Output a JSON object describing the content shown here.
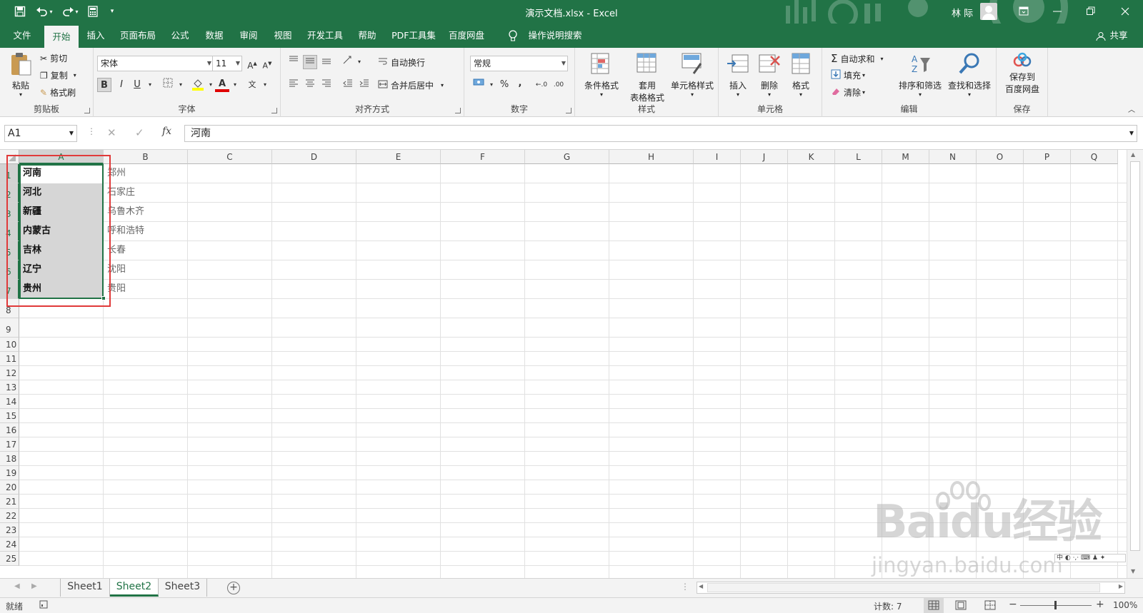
{
  "window": {
    "title": "演示文档.xlsx  -  Excel",
    "user": "林 际"
  },
  "quick_access": {
    "save": "save-icon",
    "undo": "undo-icon",
    "redo": "redo-icon"
  },
  "tabs": [
    "文件",
    "开始",
    "插入",
    "页面布局",
    "公式",
    "数据",
    "审阅",
    "视图",
    "开发工具",
    "帮助",
    "PDF工具集",
    "百度网盘",
    "操作说明搜索"
  ],
  "active_tab": "开始",
  "share": "共享",
  "ribbon": {
    "clipboard": {
      "paste": "粘贴",
      "cut": "剪切",
      "copy": "复制",
      "format_painter": "格式刷",
      "label": "剪贴板"
    },
    "font": {
      "name": "宋体",
      "size": "11",
      "bold": "B",
      "italic": "I",
      "underline": "U",
      "phonetic": "文",
      "label": "字体"
    },
    "alignment": {
      "wrap": "自动换行",
      "merge": "合并后居中",
      "label": "对齐方式"
    },
    "number": {
      "format": "常规",
      "percent": "%",
      "comma": ",",
      "label": "数字"
    },
    "styles": {
      "conditional": "条件格式",
      "table_line1": "套用",
      "table_line2": "表格格式",
      "cell_styles": "单元格样式",
      "label": "样式"
    },
    "cells": {
      "insert": "插入",
      "delete": "删除",
      "format": "格式",
      "label": "单元格"
    },
    "editing": {
      "autosum": "自动求和",
      "fill": "填充",
      "clear": "清除",
      "sort": "排序和筛选",
      "find": "查找和选择",
      "label": "编辑"
    },
    "save": {
      "line1": "保存到",
      "line2": "百度网盘",
      "label": "保存"
    }
  },
  "formula_bar": {
    "name_box": "A1",
    "fx": "fx",
    "value": "河南"
  },
  "columns": [
    "A",
    "B",
    "C",
    "D",
    "E",
    "F",
    "G",
    "H",
    "I",
    "J",
    "K",
    "L",
    "M",
    "N",
    "O",
    "P",
    "Q"
  ],
  "rows": [
    "1",
    "2",
    "3",
    "4",
    "5",
    "6",
    "7",
    "8",
    "9",
    "10",
    "11",
    "12",
    "13",
    "14",
    "15",
    "16",
    "17",
    "18",
    "19",
    "20",
    "21",
    "22",
    "23",
    "24",
    "25"
  ],
  "cells": {
    "A": [
      "河南",
      "河北",
      "新疆",
      "内蒙古",
      "吉林",
      "辽宁",
      "贵州"
    ],
    "B": [
      "郑州",
      "石家庄",
      "乌鲁木齐",
      "呼和浩特",
      "长春",
      "沈阳",
      "贵阳"
    ]
  },
  "sheets": [
    "Sheet1",
    "Sheet2",
    "Sheet3"
  ],
  "active_sheet": "Sheet2",
  "status": {
    "mode": "就绪",
    "count": "计数: 7",
    "zoom": "100%"
  },
  "watermark": {
    "logo": "Baidu经验",
    "url": "jingyan.baidu.com"
  },
  "colors": {
    "excel_green": "#217346",
    "highlight_red": "#e03a3a",
    "selection_fill": "#d6d6d6"
  }
}
